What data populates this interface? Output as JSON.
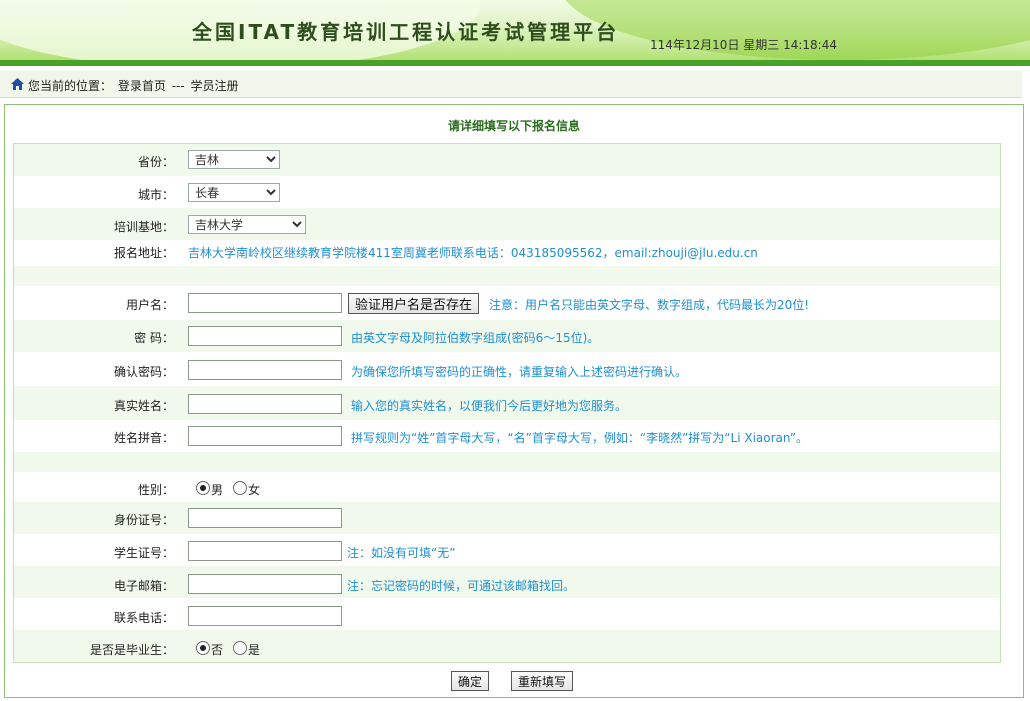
{
  "header": {
    "title": "全国ITAT教育培训工程认证考试管理平台",
    "datetime": "114年12月10日 星期三 14:18:44"
  },
  "breadcrumb": {
    "prefix": "您当前的位置：",
    "home": "登录首页",
    "separator": "---",
    "current": "学员注册"
  },
  "form": {
    "title": "请详细填写以下报名信息",
    "province": {
      "label": "省份：",
      "value": "吉林"
    },
    "city": {
      "label": "城市：",
      "value": "长春"
    },
    "base": {
      "label": "培训基地：",
      "value": "吉林大学"
    },
    "address": {
      "label": "报名地址：",
      "value": "吉林大学南岭校区继续教育学院楼411室周冀老师联系电话：043185095562，email:zhouji@jlu.edu.cn"
    },
    "username": {
      "label": "用户名：",
      "value": "",
      "check_button": "验证用户名是否存在",
      "note": "注意：用户名只能由英文字母、数字组成，代码最长为20位!"
    },
    "password": {
      "label": "密  码：",
      "value": "",
      "note": "由英文字母及阿拉伯数字组成(密码6～15位)。"
    },
    "confirm": {
      "label": "确认密码：",
      "value": "",
      "note": "为确保您所填写密码的正确性，请重复输入上述密码进行确认。"
    },
    "realname": {
      "label": "真实姓名：",
      "value": "",
      "note": "输入您的真实姓名，以便我们今后更好地为您服务。"
    },
    "pinyin": {
      "label": "姓名拼音：",
      "value": "",
      "note": "拼写规则为“姓”首字母大写，“名”首字母大写，例如：“李晓然”拼写为“Li Xiaoran”。"
    },
    "gender": {
      "label": "性别：",
      "options": [
        "男",
        "女"
      ],
      "selected": "男"
    },
    "idcard": {
      "label": "身份证号：",
      "value": ""
    },
    "studentid": {
      "label": "学生证号：",
      "value": "",
      "note": "注：如没有可填“无”"
    },
    "email": {
      "label": "电子邮箱：",
      "value": "",
      "note": "注：忘记密码的时候，可通过该邮箱找回。"
    },
    "phone": {
      "label": "联系电话：",
      "value": ""
    },
    "graduate": {
      "label": "是否是毕业生：",
      "options": [
        "否",
        "是"
      ],
      "selected": "否"
    }
  },
  "buttons": {
    "submit": "确定",
    "reset": "重新填写"
  },
  "colors": {
    "accent": "#4aa22a",
    "note": "#1f8fd1",
    "title": "#2a6e1e"
  }
}
